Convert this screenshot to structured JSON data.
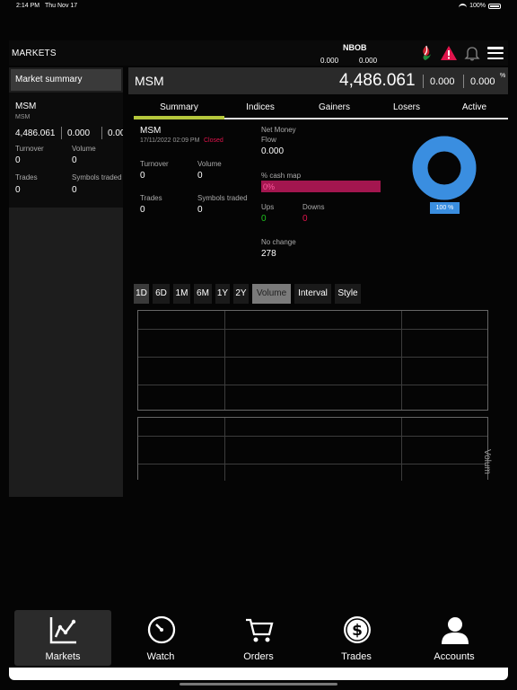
{
  "status": {
    "time": "2:14 PM",
    "date": "Thu Nov 17",
    "battery": "100%"
  },
  "header": {
    "title": "MARKETS",
    "account": "NBOB",
    "value1": "0.000",
    "value2": "0.000",
    "icons": [
      "oman-logo-icon",
      "warning-icon",
      "bell-icon",
      "menu-icon"
    ],
    "colors": {
      "warning": "#e0144c"
    }
  },
  "left": {
    "tab_label": "Market summary",
    "card": {
      "name": "MSM",
      "sub": "MSM",
      "price": "4,486.061",
      "change": "0.000",
      "pct": "0.00",
      "turnover_label": "Turnover",
      "turnover": "0",
      "volume_label": "Volume",
      "volume": "0",
      "trades_label": "Trades",
      "trades": "0",
      "symbols_label": "Symbols traded",
      "symbols": "0"
    }
  },
  "main": {
    "symbol": "MSM",
    "price": "4,486.061",
    "change": "0.000",
    "pct": "0.000",
    "pct_symbol": "%"
  },
  "tabs": [
    "Summary",
    "Indices",
    "Gainers",
    "Losers",
    "Active"
  ],
  "summary": {
    "name": "MSM",
    "datetime": "17/11/2022 02:09 PM",
    "state": "Closed",
    "turnover_label": "Turnover",
    "turnover": "0",
    "volume_label": "Volume",
    "volume": "0",
    "trades_label": "Trades",
    "trades": "0",
    "symbols_label": "Symbols traded",
    "symbols": "0",
    "net_money_label1": "Net Money",
    "net_money_label2": "Flow",
    "net_money": "0.000",
    "cash_map_label": "% cash map",
    "cash_map_value": "0%",
    "ups_label": "Ups",
    "ups": "0",
    "downs_label": "Downs",
    "downs": "0",
    "no_change_label": "No change",
    "no_change": "278",
    "donut_label": "100 %",
    "donut_fraction": 1.0,
    "colors": {
      "closed": "#e0144c",
      "ups": "#1fc21f",
      "downs": "#e0144c",
      "donut": "#3a8ee0",
      "cash_bar": "#a3164f"
    }
  },
  "ranges": [
    "1D",
    "6D",
    "1M",
    "6M",
    "1Y",
    "2Y",
    "Volume",
    "Interval",
    "Style"
  ],
  "selected_range": "1D",
  "volume_axis_label": "Volum",
  "nav": [
    {
      "label": "Markets",
      "icon": "chart-line-icon"
    },
    {
      "label": "Watch",
      "icon": "clock-gauge-icon"
    },
    {
      "label": "Orders",
      "icon": "cart-icon"
    },
    {
      "label": "Trades",
      "icon": "dollar-coin-icon"
    },
    {
      "label": "Accounts",
      "icon": "user-icon"
    }
  ],
  "selected_nav": "Markets"
}
